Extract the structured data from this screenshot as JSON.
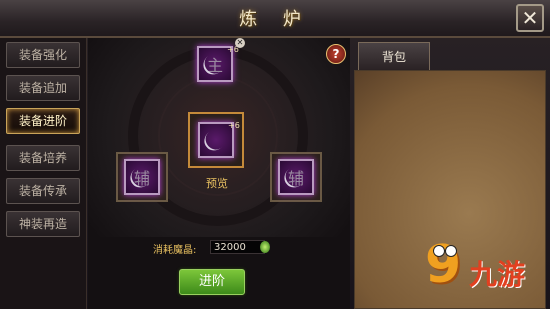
{
  "window": {
    "title": "炼 炉",
    "close_icon": "close-icon"
  },
  "tabs": [
    {
      "label": "装备强化",
      "active": false
    },
    {
      "label": "装备追加",
      "active": false
    },
    {
      "label": "装备进阶",
      "active": true
    },
    {
      "label": "装备培养",
      "active": false
    },
    {
      "label": "装备传承",
      "active": false
    },
    {
      "label": "神装再造",
      "active": false
    }
  ],
  "forge": {
    "top_slot": {
      "glyph": "主",
      "level": "+6",
      "icon": "bow-icon"
    },
    "center_slot": {
      "level": "+6",
      "icon": "bow-icon",
      "label": "预览"
    },
    "left_slot": {
      "glyph": "辅",
      "icon": "bow-icon"
    },
    "right_slot": {
      "glyph": "辅",
      "icon": "bow-icon"
    },
    "help": "?"
  },
  "cost": {
    "label": "消耗魔晶:",
    "value": "32000",
    "icon": "green-gem-icon"
  },
  "advance_button": "进阶",
  "bag": {
    "tab": "背包"
  },
  "watermark": {
    "digit": "9",
    "text": "九游"
  },
  "colors": {
    "active_tab_border": "#c9a45a",
    "button_green": "#6bb832",
    "title": "#f3e7c8"
  }
}
